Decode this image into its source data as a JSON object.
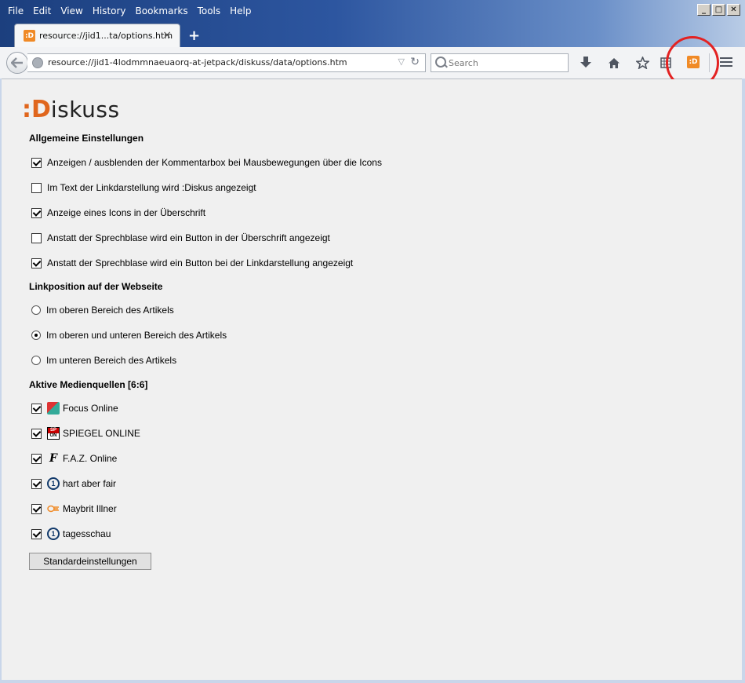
{
  "menubar": {
    "items": [
      "File",
      "Edit",
      "View",
      "History",
      "Bookmarks",
      "Tools",
      "Help"
    ]
  },
  "tab": {
    "title": "resource://jid1...ta/options.htm",
    "favicon_text": ":D",
    "close": "×"
  },
  "new_tab": "+",
  "navbar": {
    "url": "resource://jid1-4lodmmnaeuaorq-at-jetpack/diskuss/data/options.htm",
    "search_placeholder": "Search",
    "addon_icon_text": ":D"
  },
  "logo": {
    "mark": ":D",
    "text": "iskuss"
  },
  "sections": {
    "general": {
      "title": "Allgemeine Einstellungen",
      "options": [
        {
          "label": "Anzeigen / ausblenden der Kommentarbox bei Mausbewegungen über die Icons",
          "checked": true
        },
        {
          "label": "Im Text der Linkdarstellung wird :Diskus angezeigt",
          "checked": false
        },
        {
          "label": "Anzeige eines Icons in der Überschrift",
          "checked": true
        },
        {
          "label": "Anstatt der Sprechblase wird ein Button in der Überschrift angezeigt",
          "checked": false
        },
        {
          "label": "Anstatt der Sprechblase wird ein Button bei der Linkdarstellung angezeigt",
          "checked": true
        }
      ]
    },
    "link_position": {
      "title": "Linkposition auf der Webseite",
      "options": [
        {
          "label": "Im oberen Bereich des Artikels",
          "selected": false
        },
        {
          "label": "Im oberen und unteren Bereich des Artikels",
          "selected": true
        },
        {
          "label": "Im unteren Bereich des Artikels",
          "selected": false
        }
      ]
    },
    "media": {
      "title": "Aktive Medienquellen [6:6]",
      "sources": [
        {
          "label": "Focus Online",
          "icon": "focus-icon",
          "checked": true
        },
        {
          "label": "SPIEGEL ONLINE",
          "icon": "spiegel-icon",
          "checked": true
        },
        {
          "label": "F.A.Z. Online",
          "icon": "faz-icon",
          "checked": true
        },
        {
          "label": "hart aber fair",
          "icon": "ard-icon",
          "checked": true
        },
        {
          "label": "Maybrit Illner",
          "icon": "zdf-icon",
          "checked": true
        },
        {
          "label": "tagesschau",
          "icon": "ard-icon",
          "checked": true
        }
      ]
    }
  },
  "icon_glyphs": {
    "spiegel_top": "SP",
    "spiegel_bottom": "ON",
    "faz": "F",
    "ard": "1",
    "zdf": "ZDF"
  },
  "default_button": "Standardeinstellungen",
  "colors": {
    "accent": "#f08a26",
    "highlight_circle": "#e32222"
  }
}
